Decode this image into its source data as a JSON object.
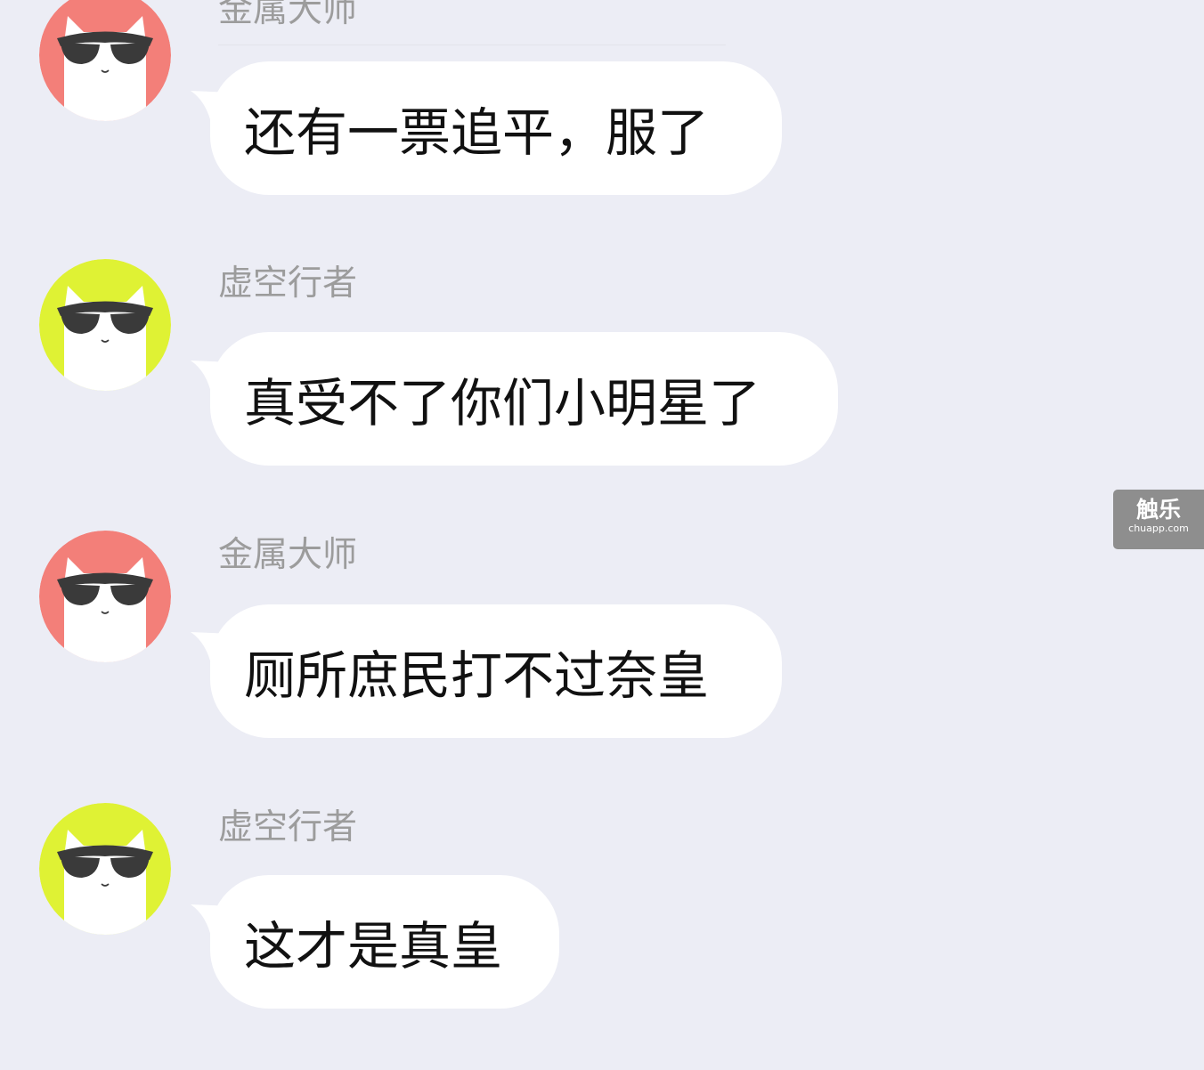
{
  "colors": {
    "background": "#ecedf5",
    "bubble": "#ffffff",
    "sender_name": "#9c9c9c",
    "avatar_red": "#f37f79",
    "avatar_yellow": "#dff234"
  },
  "messages": [
    {
      "sender": "金属大师",
      "avatar_color": "#f37f79",
      "avatar_icon": "cat-sunglasses-icon",
      "text": "还有一票追平，服了"
    },
    {
      "sender": "虚空行者",
      "avatar_color": "#dff234",
      "avatar_icon": "cat-sunglasses-icon",
      "text": "真受不了你们小明星了"
    },
    {
      "sender": "金属大师",
      "avatar_color": "#f37f79",
      "avatar_icon": "cat-sunglasses-icon",
      "text": "厕所庶民打不过奈皇"
    },
    {
      "sender": "虚空行者",
      "avatar_color": "#dff234",
      "avatar_icon": "cat-sunglasses-icon",
      "text": "这才是真皇"
    }
  ],
  "watermark": {
    "main": "触乐",
    "sub": "chuapp.com"
  }
}
